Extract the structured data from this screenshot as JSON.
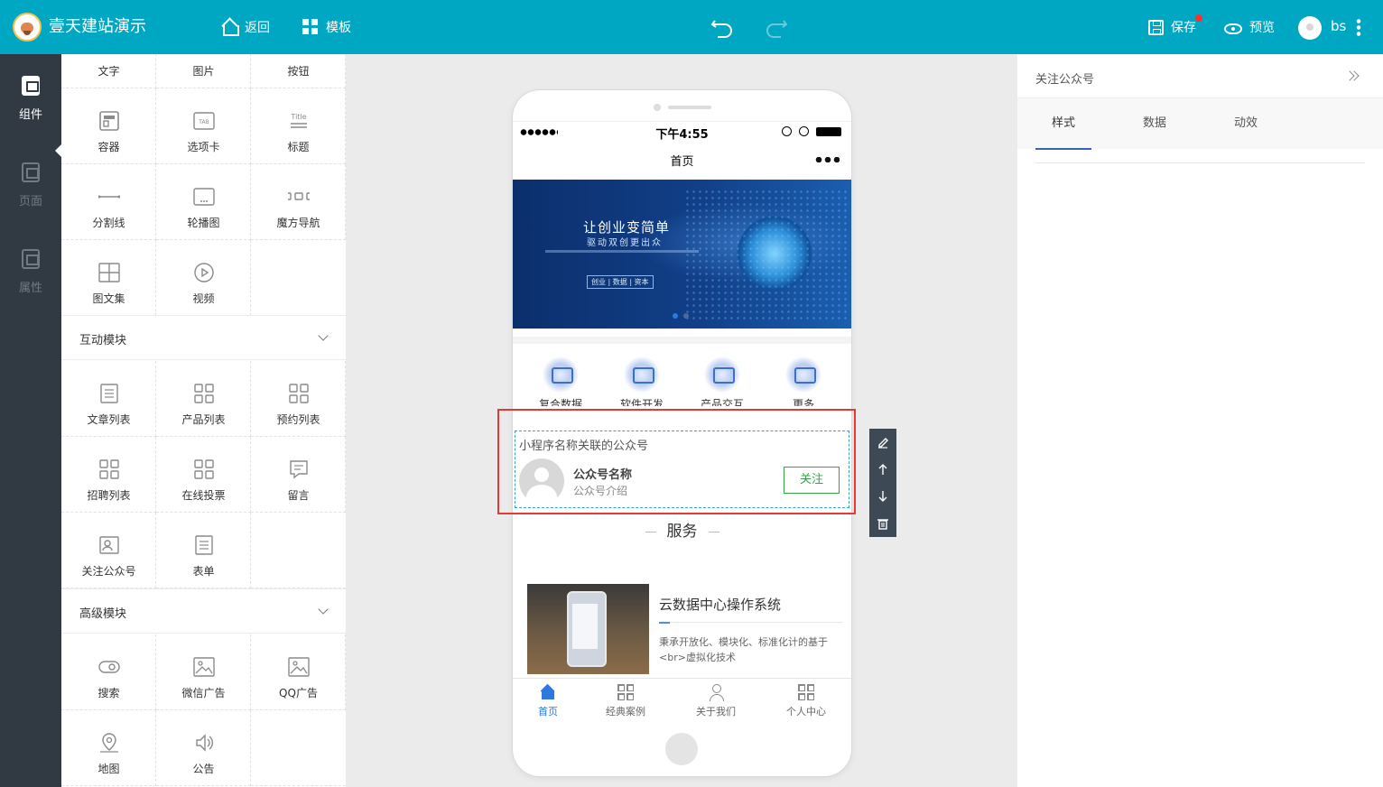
{
  "topbar": {
    "site_title": "壹天建站演示",
    "back_label": "返回",
    "template_label": "模板",
    "save_label": "保存",
    "preview_label": "预览",
    "username": "bs"
  },
  "leftnav": {
    "items": [
      {
        "label": "组件",
        "active": true
      },
      {
        "label": "页面",
        "active": false
      },
      {
        "label": "属性",
        "active": false
      }
    ]
  },
  "components": {
    "basic": [
      "文字",
      "图片",
      "按钮",
      "容器",
      "选项卡",
      "标题",
      "分割线",
      "轮播图",
      "魔方导航",
      "图文集",
      "视频"
    ],
    "interactive_title": "互动模块",
    "interactive": [
      "文章列表",
      "产品列表",
      "预约列表",
      "招聘列表",
      "在线投票",
      "留言",
      "关注公众号",
      "表单"
    ],
    "advanced_title": "高级模块",
    "advanced": [
      "搜索",
      "微信广告",
      "QQ广告",
      "地图",
      "公告"
    ],
    "icon_text_tab": "TAB",
    "icon_text_title": "Title"
  },
  "phone": {
    "status_time": "下午4:55",
    "page_title": "首页",
    "banner": {
      "title": "让创业变简单",
      "subtitle": "驱动双创更出众",
      "tag": "创业 | 数据 | 资本"
    },
    "icon_nav": [
      "复合数据",
      "软件开发",
      "产品交互",
      "更多"
    ],
    "follow": {
      "header": "小程序名称关联的公众号",
      "name": "公众号名称",
      "intro": "公众号介绍",
      "button": "关注"
    },
    "service_title": "服务",
    "article": {
      "title": "云数据中心操作系统",
      "desc": "秉承开放化、模块化、标准化计的基于<br>虚拟化技术"
    },
    "tabbar": [
      {
        "label": "首页",
        "active": true
      },
      {
        "label": "经典案例",
        "active": false
      },
      {
        "label": "关于我们",
        "active": false
      },
      {
        "label": "个人中心",
        "active": false
      }
    ]
  },
  "right_panel": {
    "title": "关注公众号",
    "tabs": [
      {
        "label": "样式",
        "active": true
      },
      {
        "label": "数据",
        "active": false
      },
      {
        "label": "动效",
        "active": false
      }
    ]
  },
  "colors": {
    "topbar": "#00a7c3",
    "sidebar": "#313a43",
    "selection": "#e53935",
    "follow_button": "#35a345",
    "tab_active": "#2f78e0"
  }
}
